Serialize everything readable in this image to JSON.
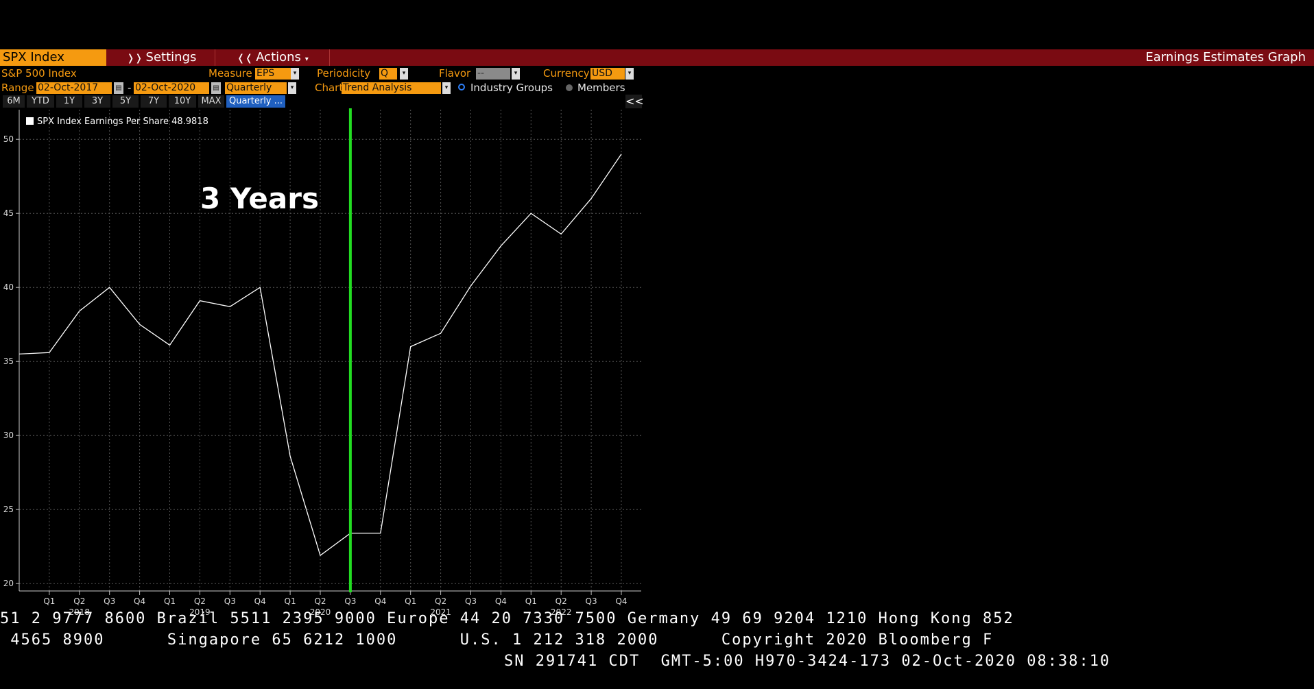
{
  "toolbar": {
    "index_label": "SPX Index",
    "settings_label": "Settings",
    "actions_label": "Actions",
    "right_title": "Earnings Estimates Graph"
  },
  "controls": {
    "security_name": "S&P 500 Index",
    "measure_label": "Measure",
    "measure_value": "EPS",
    "periodicity_label": "Periodicity",
    "periodicity_value": "Q",
    "flavor_label": "Flavor",
    "flavor_value": "--",
    "currency_label": "Currency",
    "currency_value": "USD",
    "range_label": "Range",
    "range_start": "02-Oct-2017",
    "range_sep": "-",
    "range_end": "02-Oct-2020",
    "range_period": "Quarterly",
    "chart_label": "Chart",
    "chart_value": "Trend Analysis",
    "radio_industry": "Industry Groups",
    "radio_members": "Members"
  },
  "timeframes": [
    "6M",
    "YTD",
    "1Y",
    "3Y",
    "5Y",
    "7Y",
    "10Y",
    "MAX",
    "Quarterly ..."
  ],
  "collapse_label": "<<",
  "annotation": "3 Years",
  "colors": {
    "accent": "#f59a10",
    "bar": "#7a0b12",
    "marker": "#22dd22",
    "line": "#ffffff"
  },
  "chart_data": {
    "type": "line",
    "legend": "SPX Index Earnings Per Share 48.9818",
    "ylim": [
      19.5,
      52
    ],
    "yticks": [
      20,
      25,
      30,
      35,
      40,
      45,
      50
    ],
    "quarter_labels": [
      "Q1",
      "Q2",
      "Q3",
      "Q4",
      "Q1",
      "Q2",
      "Q3",
      "Q4",
      "Q1",
      "Q2",
      "Q3",
      "Q4",
      "Q1",
      "Q2",
      "Q3",
      "Q4",
      "Q1",
      "Q2",
      "Q3",
      "Q4"
    ],
    "year_labels": [
      {
        "label": "2018",
        "at_index": 2
      },
      {
        "label": "2019",
        "at_index": 6
      },
      {
        "label": "2020",
        "at_index": 10
      },
      {
        "label": "2021",
        "at_index": 14
      },
      {
        "label": "2022",
        "at_index": 18
      }
    ],
    "marker_at_index": 11,
    "series": [
      {
        "name": "SPX Index Earnings Per Share",
        "values": [
          35.5,
          35.6,
          38.4,
          40.0,
          37.5,
          36.1,
          39.1,
          38.7,
          40.0,
          28.6,
          21.9,
          23.4,
          23.4,
          36.0,
          36.9,
          40.1,
          42.8,
          45.0,
          43.6,
          46.0,
          49.0
        ]
      }
    ]
  },
  "ticker": {
    "line1": "51 2 9777 8600 Brazil 5511 2395 9000 Europe 44 20 7330 7500 Germany 49 69 9204 1210 Hong Kong 852",
    "line2": " 4565 8900      Singapore 65 6212 1000      U.S. 1 212 318 2000      Copyright 2020 Bloomberg F",
    "line3": "SN 291741 CDT  GMT-5:00 H970-3424-173 02-Oct-2020 08:38:10"
  }
}
